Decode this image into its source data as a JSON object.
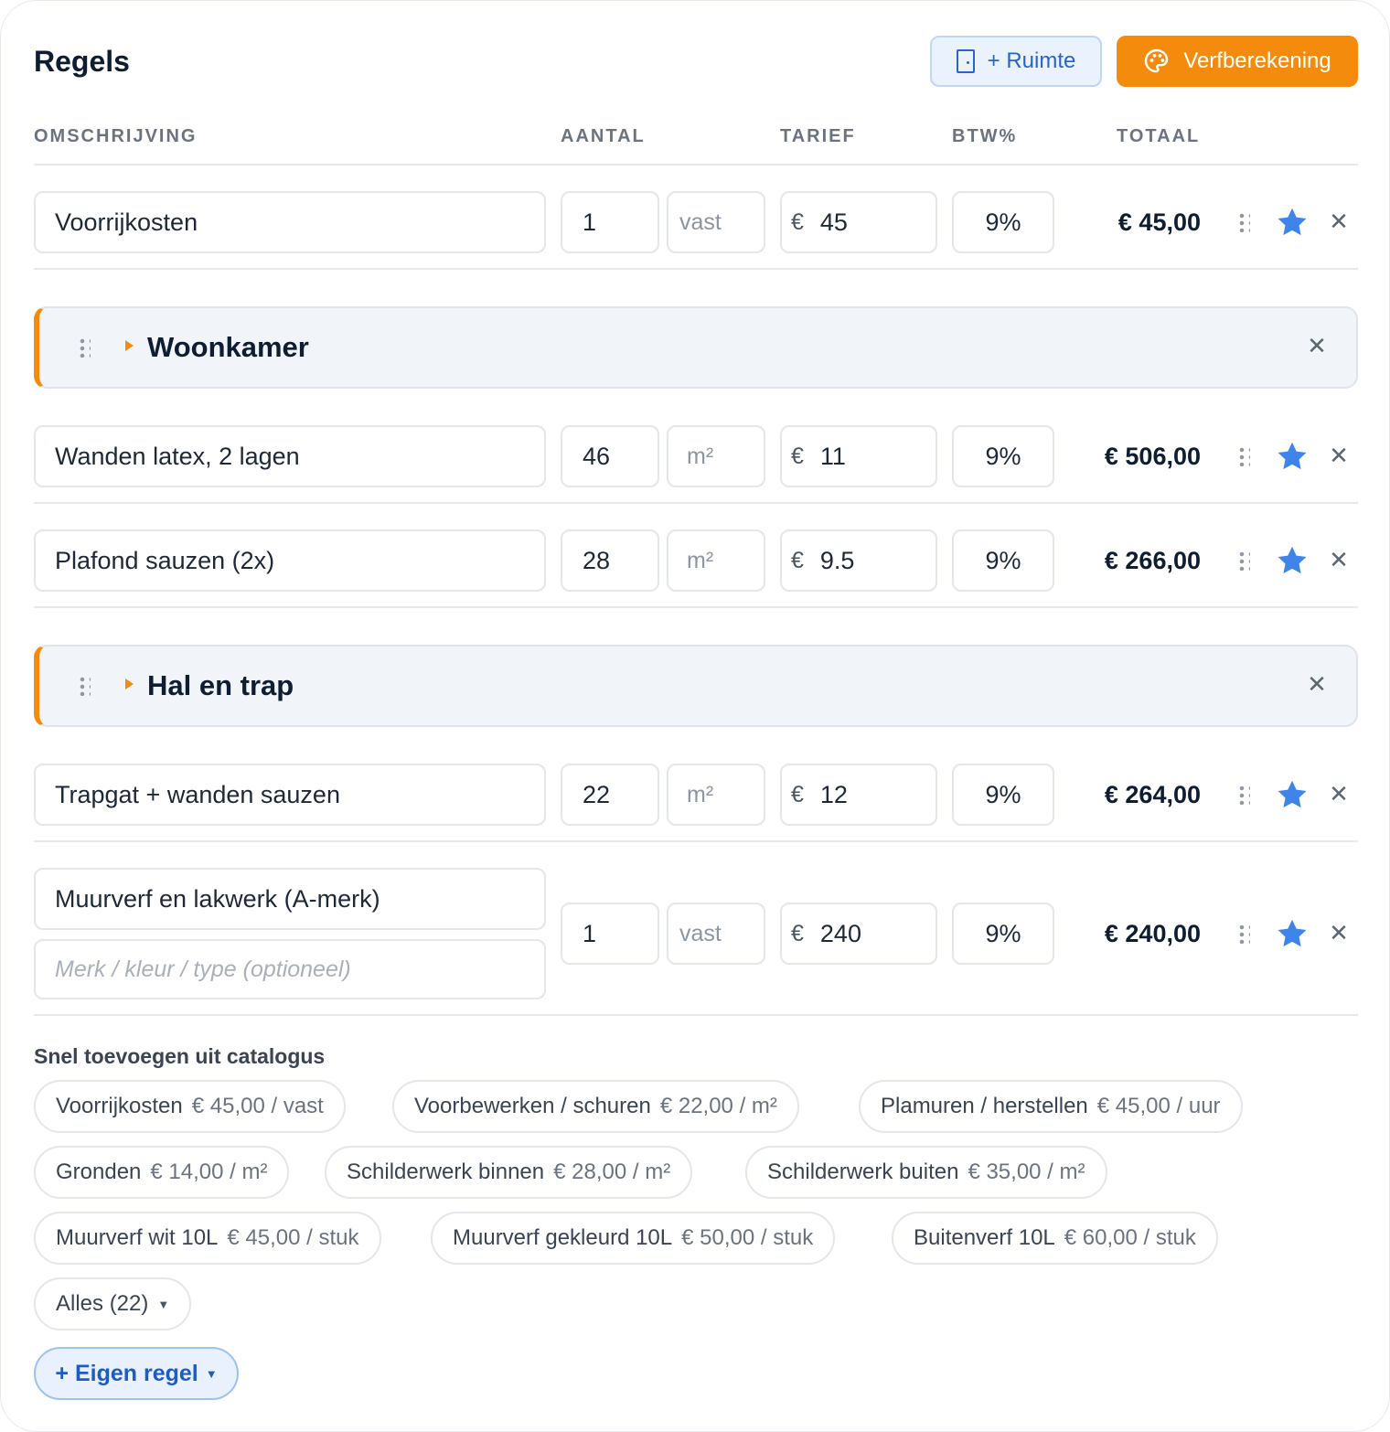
{
  "header": {
    "title": "Regels",
    "ruimte_label": "+ Ruimte",
    "verf_label": "Verfberekening",
    "accent_color": "#f58b0d",
    "primary_color": "#2a64c9"
  },
  "columns": [
    "OMSCHRIJVING",
    "AANTAL",
    "TARIEF",
    "BTW%",
    "TOTAAL"
  ],
  "rows": [
    {
      "description": "Voorrijkosten",
      "quantity": "1",
      "unit": "vast",
      "currency": "€",
      "rate": "45",
      "vat": "9%",
      "total": "€ 45,00"
    },
    {
      "description": "Wanden latex, 2 lagen",
      "quantity": "46",
      "unit": "m²",
      "currency": "€",
      "rate": "11",
      "vat": "9%",
      "total": "€ 506,00"
    },
    {
      "description": "Plafond sauzen (2x)",
      "quantity": "28",
      "unit": "m²",
      "currency": "€",
      "rate": "9.5",
      "vat": "9%",
      "total": "€ 266,00"
    },
    {
      "description": "Trapgat + wanden sauzen",
      "quantity": "22",
      "unit": "m²",
      "currency": "€",
      "rate": "12",
      "vat": "9%",
      "total": "€ 264,00"
    },
    {
      "description": "Muurverf en lakwerk (A-merk)",
      "detail_placeholder": "Merk / kleur / type (optioneel)",
      "quantity": "1",
      "unit": "vast",
      "currency": "€",
      "rate": "240",
      "vat": "9%",
      "total": "€ 240,00"
    }
  ],
  "sections": [
    {
      "name": "Woonkamer"
    },
    {
      "name": "Hal en trap"
    }
  ],
  "catalog": {
    "label": "Snel toevoegen uit catalogus",
    "items": [
      {
        "name": "Voorrijkosten",
        "price": "€ 45,00 / vast"
      },
      {
        "name": "Voorbewerken / schuren",
        "price": "€ 22,00 / m²"
      },
      {
        "name": "Plamuren / herstellen",
        "price": "€ 45,00 / uur"
      },
      {
        "name": "Gronden",
        "price": "€ 14,00 / m²"
      },
      {
        "name": "Schilderwerk binnen",
        "price": "€ 28,00 / m²"
      },
      {
        "name": "Schilderwerk buiten",
        "price": "€ 35,00 / m²"
      },
      {
        "name": "Muurverf wit 10L",
        "price": "€ 45,00 / stuk"
      },
      {
        "name": "Muurverf gekleurd 10L",
        "price": "€ 50,00 / stuk"
      },
      {
        "name": "Buitenverf 10L",
        "price": "€ 60,00 / stuk"
      }
    ],
    "all_label": "Alles (22)"
  },
  "eigen_regel_label": "+ Eigen regel",
  "icons": {
    "drag": "drag-handle-icon",
    "star": "star-icon",
    "close": "close-icon",
    "palette": "palette-icon",
    "door": "door-icon"
  }
}
